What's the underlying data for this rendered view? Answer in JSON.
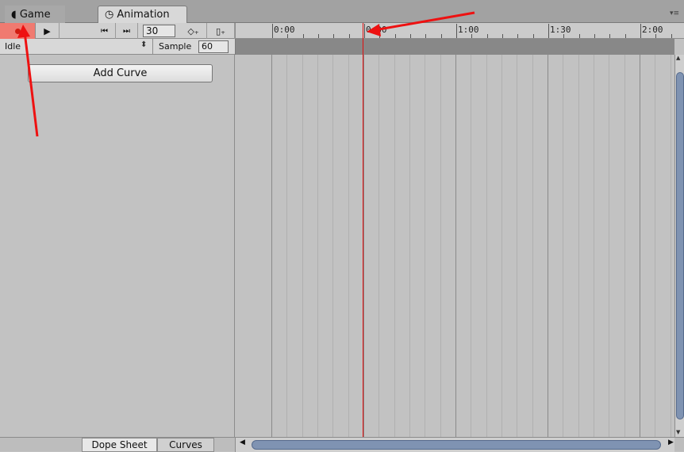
{
  "tabs": {
    "game_label": "Game",
    "animation_label": "Animation",
    "menu_glyph": "▾≡"
  },
  "toolbar": {
    "record_icon": "record-icon",
    "play_glyph": "▶",
    "prev_key_glyph": "⏮",
    "next_key_glyph": "⏭",
    "frame_value": "30",
    "add_keyframe_glyph": "◇₊",
    "add_event_glyph": "▯₊"
  },
  "ruler": {
    "labels": [
      "0:00",
      "0:30",
      "1:00",
      "1:30",
      "2:00"
    ]
  },
  "clip_row": {
    "clip_name": "Idle",
    "clip_arrows": "⬍",
    "sample_label": "Sample",
    "sample_value": "60"
  },
  "left_pane": {
    "add_curve_label": "Add Curve"
  },
  "bottom": {
    "dope_sheet_label": "Dope Sheet",
    "curves_label": "Curves",
    "scroll_left": "◀",
    "scroll_right": "▶"
  },
  "scroll": {
    "up": "▲",
    "down": "▼"
  },
  "colors": {
    "record_active": "#f07a70",
    "playhead": "#e01010",
    "annotation_arrow": "#ee1111"
  }
}
